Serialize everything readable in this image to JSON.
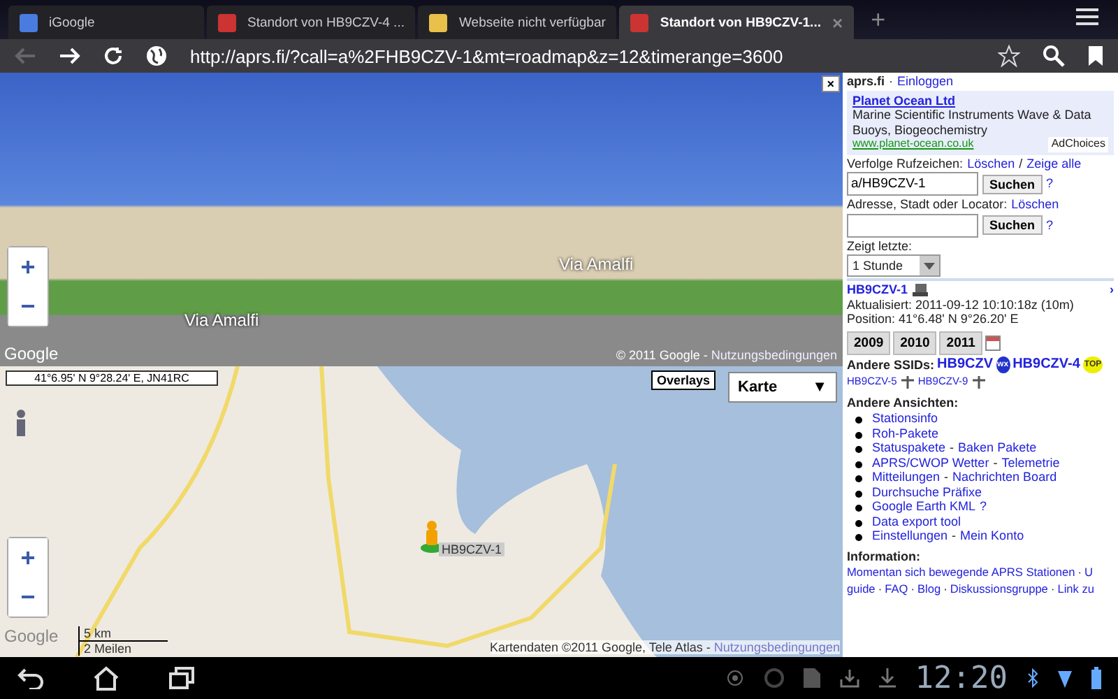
{
  "tabs": [
    {
      "title": "iGoogle",
      "selected": false,
      "kind": "google"
    },
    {
      "title": "Standort von HB9CZV-4 ...",
      "selected": false,
      "kind": "aprs"
    },
    {
      "title": "Webseite nicht verfügbar",
      "selected": false,
      "kind": "error"
    },
    {
      "title": "Standort von HB9CZV-1...",
      "selected": true,
      "kind": "aprs"
    }
  ],
  "tab_close": "×",
  "new_tab": "+",
  "address": "http://aprs.fi/?call=a%2FHB9CZV-1&mt=roadmap&z=12&timerange=3600",
  "street_view": {
    "street_labels": [
      "Via Amalfi",
      "Via Amalfi"
    ],
    "close": "×",
    "zoom_in": "+",
    "zoom_out": "−",
    "logo": "Google",
    "copyright": "© 2011 Google -",
    "terms": "Nutzungsbedingungen"
  },
  "map": {
    "coordinates": "41°6.95' N 9°28.24' E, JN41RC",
    "overlays": "Overlays",
    "map_type": "Karte",
    "map_type_caret": "▼",
    "marker_label": "HB9CZV-1",
    "zoom_in": "+",
    "zoom_out": "−",
    "scale_km": "5 km",
    "scale_mi": "2 Meilen",
    "logo": "Google",
    "attribution": "Kartendaten ©2011 Google, Tele Atlas -",
    "terms": "Nutzungsbedingungen"
  },
  "side": {
    "site": "aprs.fi",
    "dot": "·",
    "login": "Einloggen",
    "ad": {
      "title": "Planet Ocean Ltd",
      "text": "Marine Scientific Instruments Wave & Data Buoys, Biogeochemistry",
      "url": "www.planet-ocean.co.uk",
      "choices": "AdChoices"
    },
    "track": {
      "label": "Verfolge Rufzeichen:",
      "links": [
        {
          "text": "Löschen",
          "kind": "link"
        },
        {
          "text": "/",
          "kind": "text"
        },
        {
          "text": "Zeige alle",
          "kind": "link"
        }
      ],
      "value": "a/HB9CZV-1",
      "button": "Suchen",
      "help": "?"
    },
    "address": {
      "label": "Adresse, Stadt oder Locator:",
      "links": [
        {
          "text": "Löschen",
          "kind": "link"
        }
      ],
      "button": "Suchen",
      "help": "?"
    },
    "last": {
      "label": "Zeigt letzte:",
      "value": "1 Stunde"
    },
    "station": {
      "call": "HB9CZV-1",
      "updated": "Aktualisiert: 2011-09-12 10:10:18z (10m)",
      "position": "Position: 41°6.48' N 9°26.20' E",
      "more": "›"
    },
    "years": [
      {
        "label": "2009",
        "selected": false
      },
      {
        "label": "2010",
        "selected": false
      },
      {
        "label": "2011",
        "selected": false
      }
    ],
    "ssids": {
      "label": "Andere SSIDs:",
      "big": [
        {
          "call": "HB9CZV",
          "badge": "wx"
        },
        {
          "call": "HB9CZV-4",
          "badge": "TOP"
        }
      ],
      "small": [
        "HB9CZV-5",
        "HB9CZV-9"
      ]
    },
    "views": {
      "heading": "Andere Ansichten:",
      "items": [
        [
          {
            "text": "Stationsinfo",
            "kind": "link"
          }
        ],
        [
          {
            "text": "Roh-Pakete",
            "kind": "link"
          }
        ],
        [
          {
            "text": "Statuspakete",
            "kind": "link"
          },
          {
            "text": "-",
            "kind": "text"
          },
          {
            "text": "Baken Pakete",
            "kind": "link"
          }
        ],
        [
          {
            "text": "APRS/CWOP Wetter",
            "kind": "link"
          },
          {
            "text": "-",
            "kind": "text"
          },
          {
            "text": "Telemetrie",
            "kind": "link"
          }
        ],
        [
          {
            "text": "Mitteilungen",
            "kind": "link"
          },
          {
            "text": "-",
            "kind": "text"
          },
          {
            "text": "Nachrichten Board",
            "kind": "link"
          }
        ],
        [
          {
            "text": "Durchsuche Präfixe",
            "kind": "link"
          }
        ],
        [
          {
            "text": "Google Earth KML",
            "kind": "link"
          },
          {
            "text": "?",
            "kind": "link"
          }
        ],
        [
          {
            "text": "Data export tool",
            "kind": "link"
          }
        ],
        [
          {
            "text": "Einstellungen",
            "kind": "link"
          },
          {
            "text": "-",
            "kind": "text"
          },
          {
            "text": "Mein Konto",
            "kind": "link"
          }
        ]
      ]
    },
    "info": {
      "heading": "Information:",
      "lines": [
        [
          {
            "text": "Momentan sich bewegende APRS Stationen",
            "kind": "link"
          },
          {
            "text": "·",
            "kind": "text"
          },
          {
            "text": "U",
            "kind": "link"
          }
        ],
        [
          {
            "text": "guide",
            "kind": "link"
          },
          {
            "text": "·",
            "kind": "text"
          },
          {
            "text": "FAQ",
            "kind": "link"
          },
          {
            "text": "·",
            "kind": "text"
          },
          {
            "text": "Blog",
            "kind": "link"
          },
          {
            "text": "·",
            "kind": "text"
          },
          {
            "text": "Diskussionsgruppe",
            "kind": "link"
          },
          {
            "text": "·",
            "kind": "text"
          },
          {
            "text": "Link zu",
            "kind": "link"
          }
        ]
      ]
    }
  },
  "status": {
    "time": "12:20"
  }
}
